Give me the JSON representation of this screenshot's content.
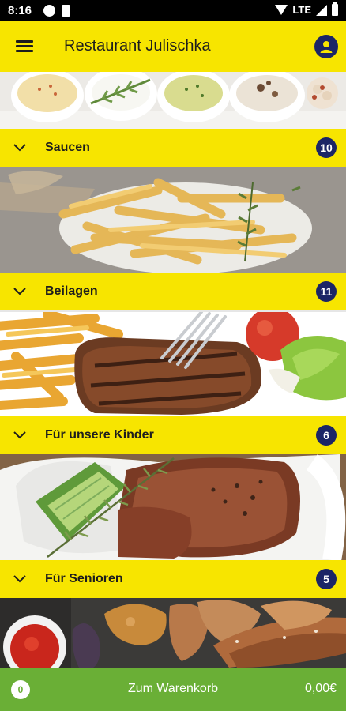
{
  "status_bar": {
    "time": "8:16",
    "network": "LTE"
  },
  "app_bar": {
    "title": "Restaurant Julischka",
    "menu_icon": "hamburger-menu-icon",
    "account_icon": "account-icon"
  },
  "categories": [
    {
      "label": "Saucen",
      "count": "10"
    },
    {
      "label": "Beilagen",
      "count": "11"
    },
    {
      "label": "Für unsere Kinder",
      "count": "6"
    },
    {
      "label": "Für Senioren",
      "count": "5"
    }
  ],
  "cart": {
    "item_count": "0",
    "label": "Zum Warenkorb",
    "total": "0,00€"
  },
  "colors": {
    "brand_yellow": "#f7e500",
    "navy": "#1b2566",
    "cart_green": "#6aaf36"
  }
}
